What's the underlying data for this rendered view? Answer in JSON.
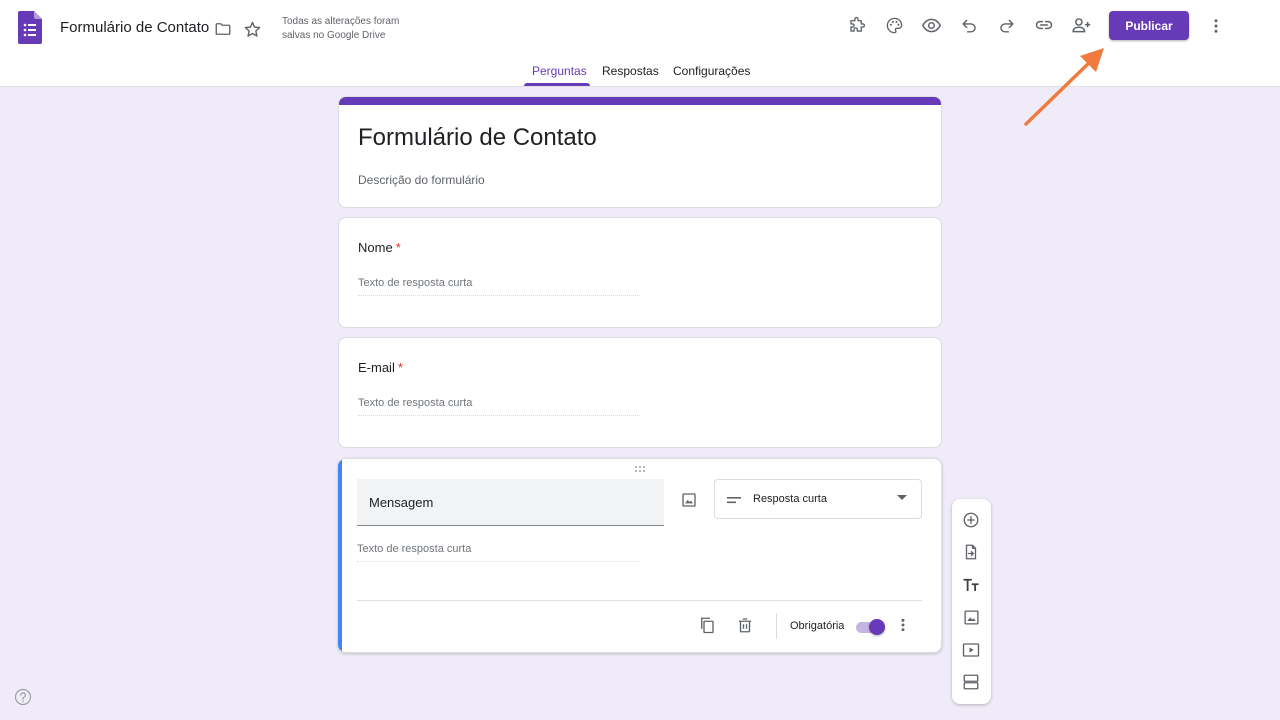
{
  "header": {
    "doc_title": "Formulário de Contato",
    "save_status": "Todas as alterações foram salvas no Google Drive",
    "publish_label": "Publicar",
    "brand_color": "#673ab7",
    "icons": [
      "folder-icon",
      "star-icon",
      "addon-icon",
      "palette-icon",
      "preview-icon",
      "undo-icon",
      "redo-icon",
      "link-icon",
      "add-collaborator-icon",
      "more-vert-icon"
    ]
  },
  "tabs": [
    {
      "label": "Perguntas",
      "active": true
    },
    {
      "label": "Respostas",
      "active": false
    },
    {
      "label": "Configurações",
      "active": false
    }
  ],
  "form": {
    "title": "Formulário de Contato",
    "description_placeholder": "Descrição do formulário",
    "questions": [
      {
        "label": "Nome",
        "required": true,
        "required_mark": "*",
        "answer_hint": "Texto de resposta curta"
      },
      {
        "label": "E-mail",
        "required": true,
        "required_mark": "*",
        "answer_hint": "Texto de resposta curta"
      }
    ],
    "active_question": {
      "value": "Mensagem",
      "type_label": "Resposta curta",
      "answer_hint": "Texto de resposta curta",
      "required_label": "Obrigatória",
      "required_on": true,
      "accent_color": "#4285f4"
    }
  },
  "side_toolbar": [
    "add-question-icon",
    "import-questions-icon",
    "add-title-icon",
    "add-image-icon",
    "add-video-icon",
    "add-section-icon"
  ]
}
